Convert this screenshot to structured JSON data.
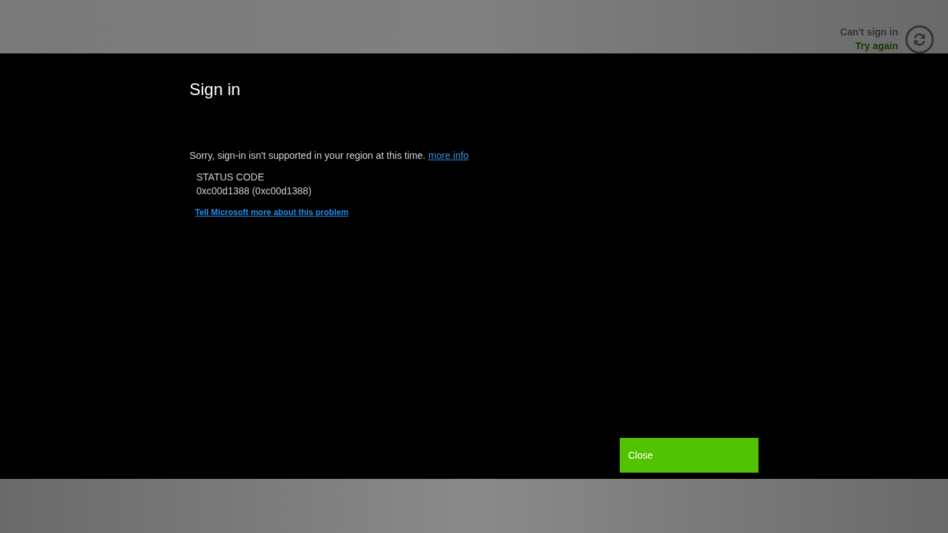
{
  "app": {
    "account_status": "Can't sign in",
    "account_action": "Try again"
  },
  "dialog": {
    "title": "Sign in",
    "message": "Sorry, sign-in isn't supported in your region at this time.",
    "message_link": "more info",
    "status_label": "STATUS CODE",
    "status_code": "0xc00d1388 (0xc00d1388)",
    "feedback_link": "Tell Microsoft more about this problem",
    "buttons": [
      "Close"
    ]
  }
}
